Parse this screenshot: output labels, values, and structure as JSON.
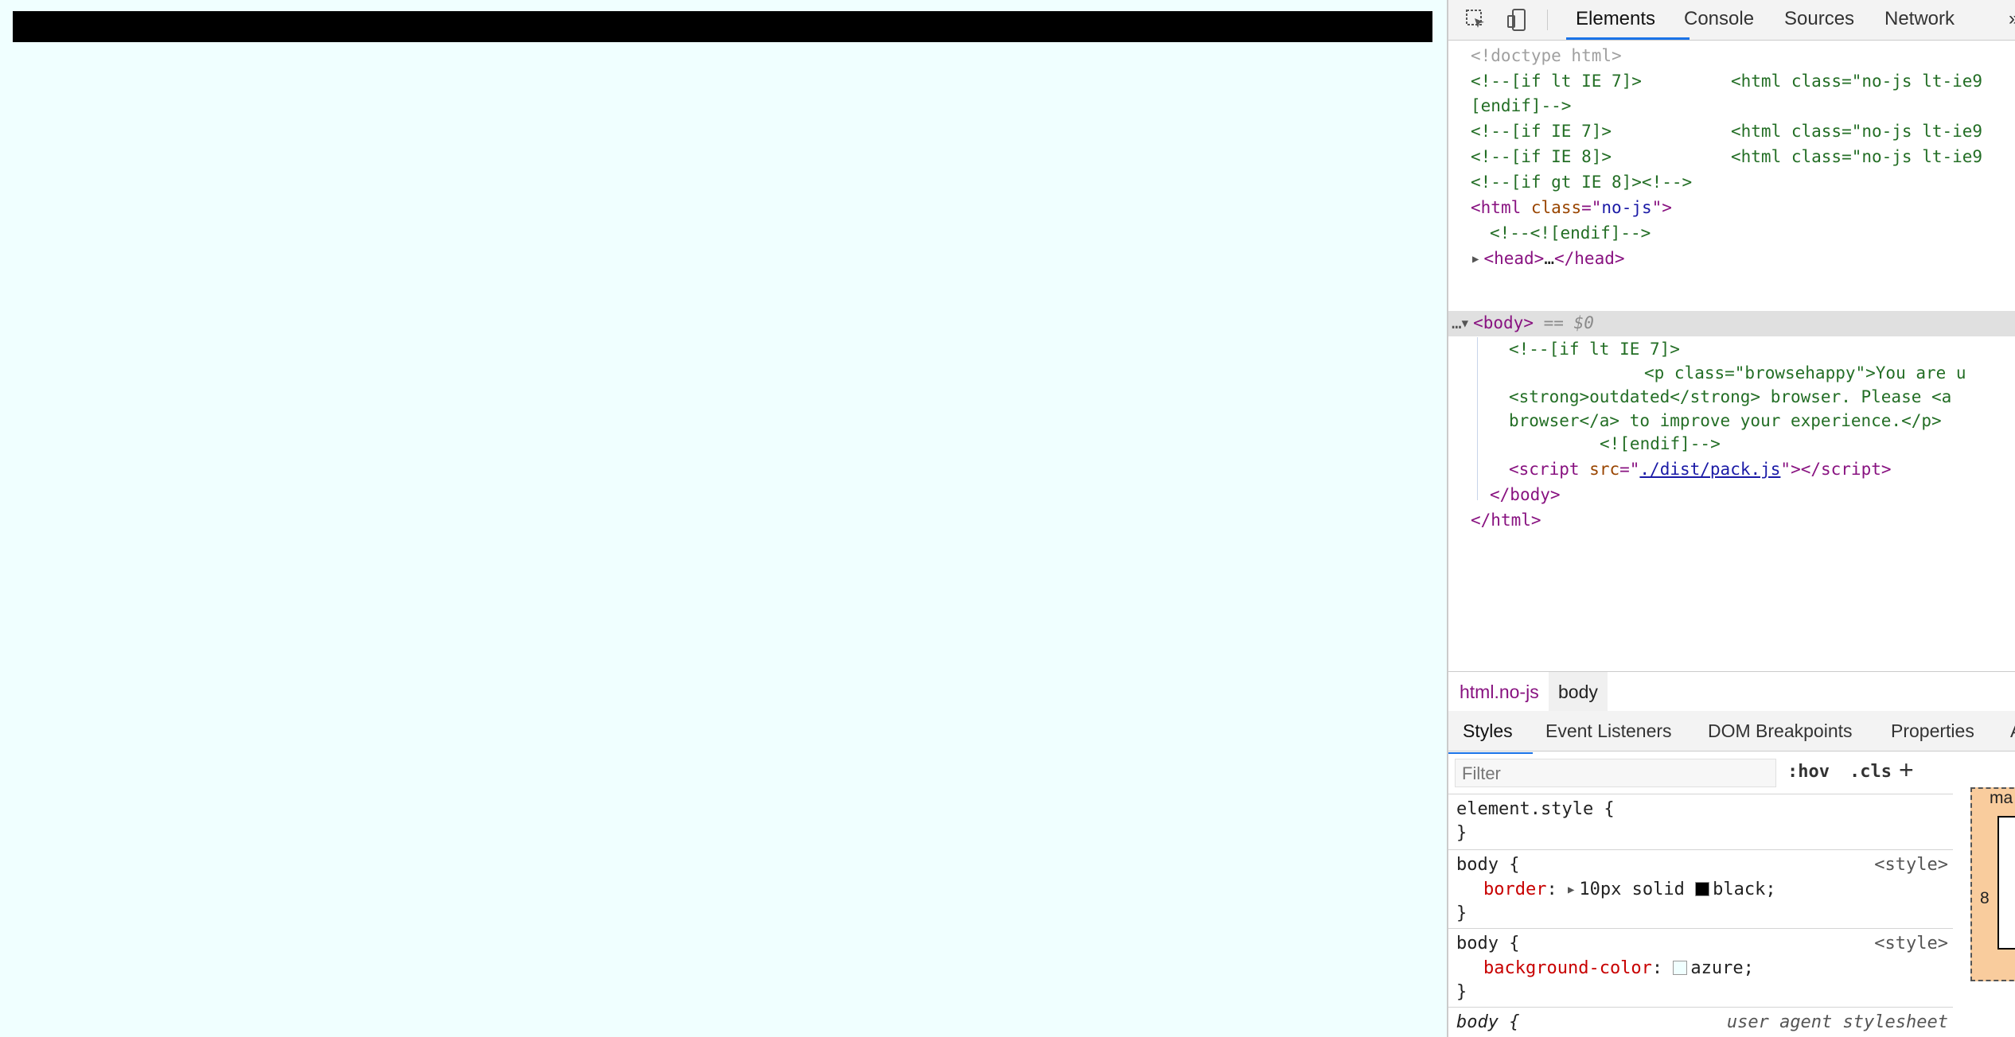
{
  "devtools": {
    "tabs": [
      "Elements",
      "Console",
      "Sources",
      "Network",
      "»"
    ],
    "icons": [
      "inspect-element-icon",
      "device-toolbar-icon"
    ],
    "dom_tree": {
      "doctype": "<!doctype html>",
      "c1a": "<!--[if lt IE 7]>",
      "c1b": "<html class=\"no-js lt-ie9",
      "c1c": "[endif]-->",
      "c2a": "<!--[if IE 7]>",
      "c2b": "<html class=\"no-js lt-ie9",
      "c3a": "<!--[if IE 8]>",
      "c3b": "<html class=\"no-js lt-ie9",
      "c4": "<!--[if gt IE 8]><!-->",
      "html_tag": "html",
      "html_attr": "class",
      "html_val": "no-js",
      "endif": "<!--<![endif]-->",
      "head_open": "head",
      "head_ellipsis": "…",
      "head_close": "/head",
      "body_tag": "body",
      "body_marker": "== $0",
      "b1": "<!--[if lt IE 7]>",
      "b2": "<p class=\"browsehappy\">You are u",
      "b3": "<strong>outdated</strong> browser. Please <a",
      "b4": "browser</a> to improve your experience.</p>",
      "b5": "<![endif]-->",
      "script_tag": "script",
      "script_attr": "src",
      "script_src": "./dist/pack.js",
      "script_close": "/script",
      "body_close": "/body",
      "html_close": "/html"
    },
    "breadcrumbs": [
      "html.no-js",
      "body"
    ],
    "subtabs": [
      "Styles",
      "Event Listeners",
      "DOM Breakpoints",
      "Properties",
      "A"
    ],
    "filter_placeholder": "Filter",
    "hov": ":hov",
    "cls": ".cls",
    "plus": "+",
    "rules": {
      "element_style": "element.style {",
      "brace": "}",
      "body_selector": "body {",
      "style_src": "<style>",
      "border_prop": "border",
      "border_val": "10px solid",
      "border_color": "black;",
      "bg_prop": "background-color",
      "bg_color": "azure;",
      "ua_body": "body {",
      "ua_src": "user agent stylesheet"
    },
    "boxmodel": {
      "label": "ma",
      "margin_left": "8"
    }
  },
  "colors": {
    "page_background": "#f0ffff",
    "body_border": "#000000",
    "accent": "#1a73e8"
  }
}
